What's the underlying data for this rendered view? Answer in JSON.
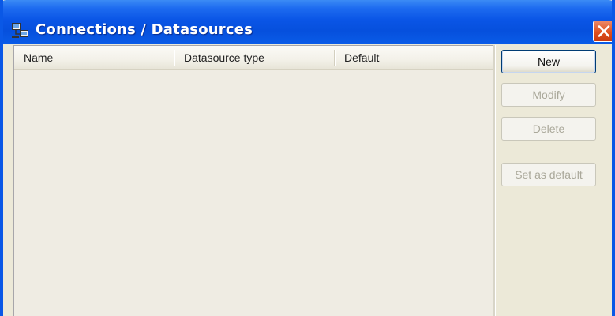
{
  "window": {
    "title": "Connections / Datasources",
    "title_icon": "connections-icon",
    "close_icon": "close-icon",
    "colors": {
      "titlebar": "#0a55e6",
      "close_button": "#e0501f",
      "client": "#ece9d8"
    }
  },
  "table": {
    "columns": [
      {
        "label": "Name"
      },
      {
        "label": "Datasource type"
      },
      {
        "label": "Default"
      }
    ],
    "rows": []
  },
  "buttons": {
    "new": {
      "label": "New",
      "enabled": true
    },
    "modify": {
      "label": "Modify",
      "enabled": false
    },
    "delete": {
      "label": "Delete",
      "enabled": false
    },
    "set_default": {
      "label": "Set as default",
      "enabled": false
    }
  }
}
